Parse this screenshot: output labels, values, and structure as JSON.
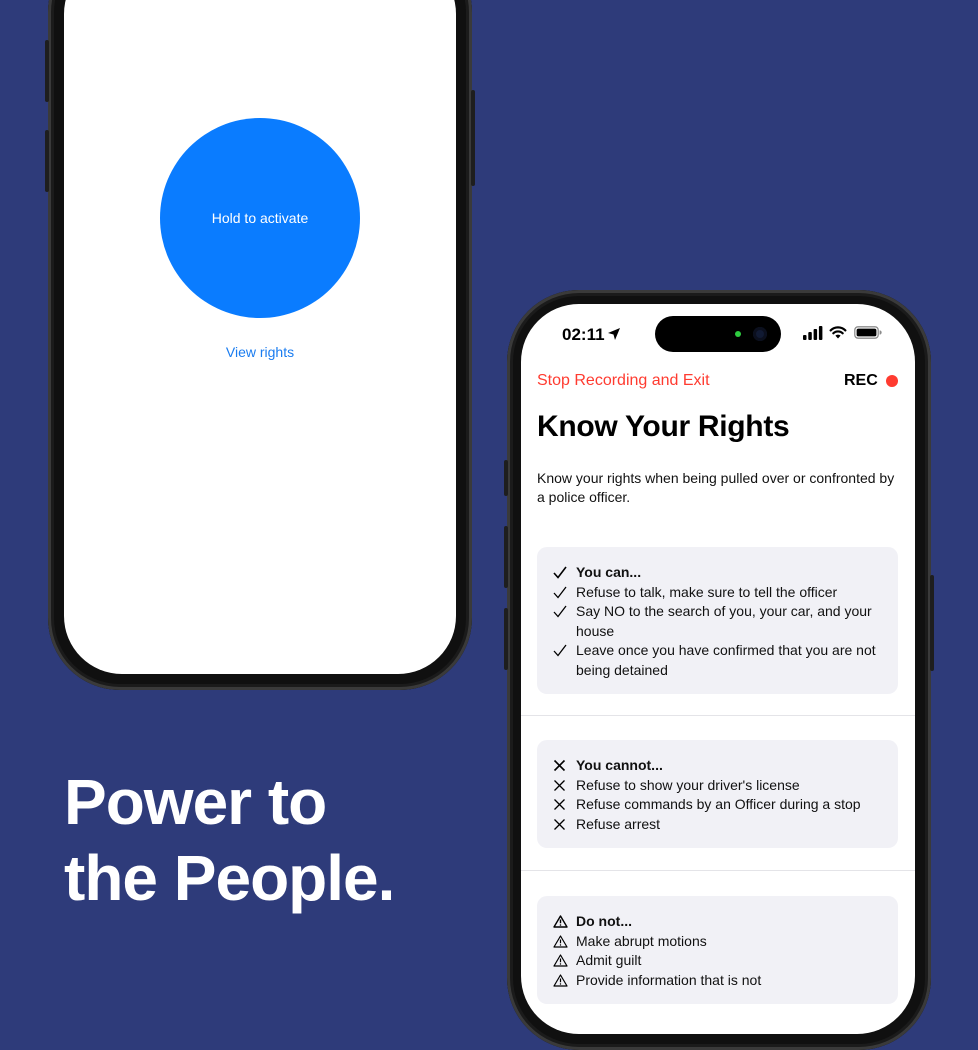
{
  "left_phone": {
    "activate_label": "Hold to activate",
    "view_rights_label": "View rights"
  },
  "tagline": {
    "line1": "Power to",
    "line2": "the People."
  },
  "right_phone": {
    "status_bar": {
      "time": "02:11"
    },
    "top_bar": {
      "stop_label": "Stop Recording and Exit",
      "rec_label": "REC"
    },
    "title": "Know Your Rights",
    "intro": "Know your rights when being pulled over or confronted by a police officer.",
    "can": {
      "heading": "You can...",
      "items": [
        "Refuse to talk, make sure to tell the officer",
        "Say NO to the search of you, your car, and your house",
        "Leave once you have confirmed that you are not being detained"
      ]
    },
    "cannot": {
      "heading": "You cannot...",
      "items": [
        "Refuse to show your driver's license",
        "Refuse commands by an Officer during a stop",
        "Refuse arrest"
      ]
    },
    "donot": {
      "heading": "Do not...",
      "items": [
        "Make abrupt motions",
        "Admit guilt",
        "Provide information that is not"
      ]
    }
  },
  "colors": {
    "background": "#2e3b7a",
    "button_blue": "#0a7cff",
    "link_blue": "#1a7cf0",
    "rec_red": "#ff3b30",
    "card_bg": "#f1f1f6"
  },
  "icons": [
    "check-icon",
    "x-icon",
    "warning-icon",
    "location-arrow-icon",
    "signal-icon",
    "wifi-icon",
    "battery-icon"
  ]
}
